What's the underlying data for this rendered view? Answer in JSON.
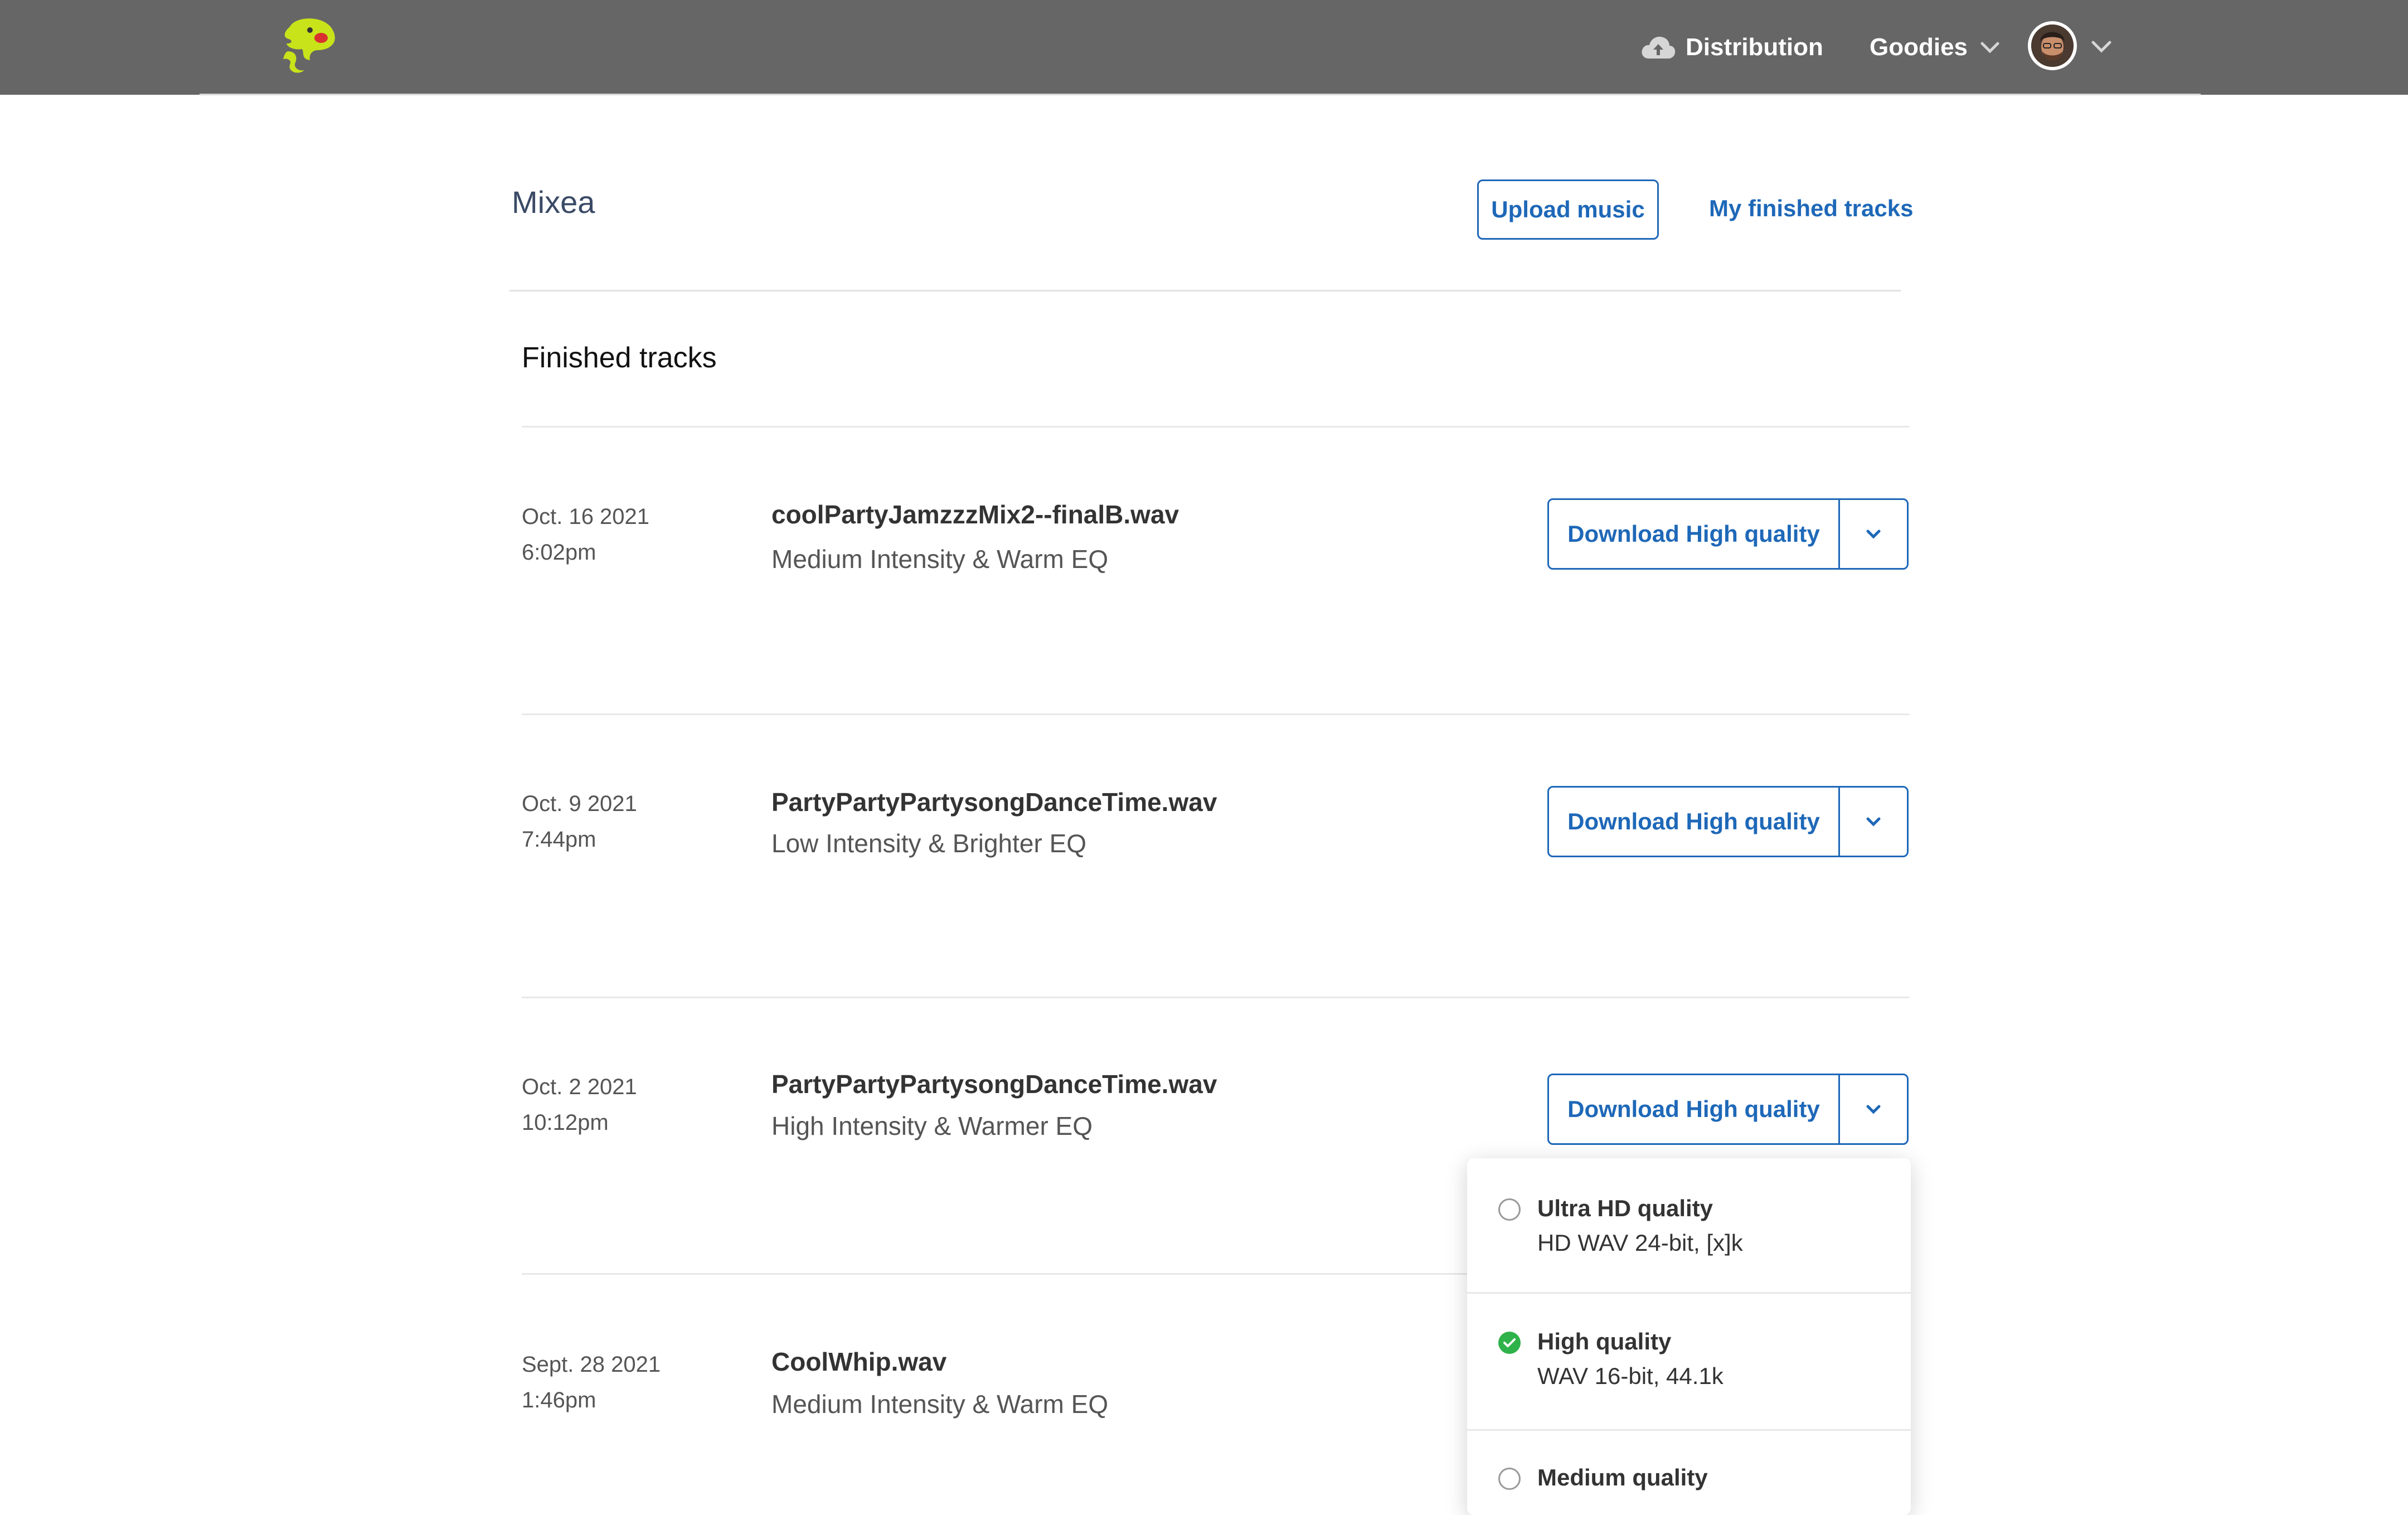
{
  "nav": {
    "distribution": "Distribution",
    "goodies": "Goodies"
  },
  "header": {
    "title": "Mixea",
    "upload_button": "Upload music",
    "finished_link": "My finished tracks"
  },
  "section_title": "Finished tracks",
  "tracks": [
    {
      "date": "Oct. 16 2021",
      "time": "6:02pm",
      "filename": "coolPartyJamzzzMix2--finalB.wav",
      "description": "Medium Intensity & Warm EQ",
      "download_label": "Download High quality"
    },
    {
      "date": "Oct. 9 2021",
      "time": "7:44pm",
      "filename": "PartyPartyPartysongDanceTime.wav",
      "description": "Low Intensity & Brighter EQ",
      "download_label": "Download High quality"
    },
    {
      "date": "Oct. 2 2021",
      "time": "10:12pm",
      "filename": "PartyPartyPartysongDanceTime.wav",
      "description": "High Intensity & Warmer EQ",
      "download_label": "Download High quality"
    },
    {
      "date": "Sept. 28 2021",
      "time": "1:46pm",
      "filename": "CoolWhip.wav",
      "description": "Medium Intensity & Warm EQ"
    }
  ],
  "quality_menu": {
    "options": [
      {
        "title": "Ultra HD quality",
        "subtitle": "HD WAV 24-bit, [x]k",
        "selected": false
      },
      {
        "title": "High quality",
        "subtitle": "WAV 16-bit, 44.1k",
        "selected": true
      },
      {
        "title": "Medium quality",
        "subtitle": "",
        "selected": false
      }
    ]
  },
  "colors": {
    "topbar": "#666666",
    "accent": "#1e68b8",
    "logo": "#c8e31a",
    "selected": "#2fb24a"
  }
}
